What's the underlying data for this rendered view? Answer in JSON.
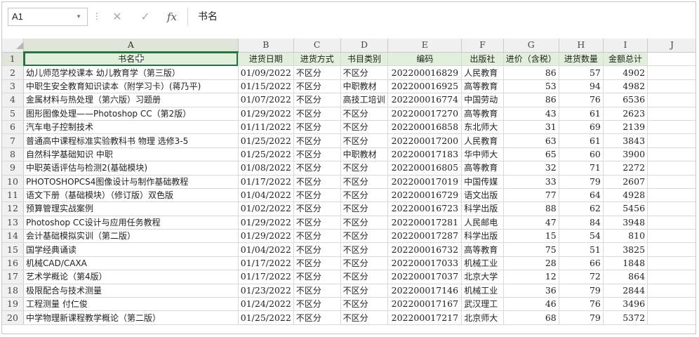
{
  "name_box": "A1",
  "formula_bar": {
    "value": "书名",
    "fx_label": "fx",
    "cancel_symbol": "✕",
    "enter_symbol": "✓"
  },
  "columns": [
    "A",
    "B",
    "C",
    "D",
    "E",
    "F",
    "G",
    "H",
    "I",
    "J"
  ],
  "headers": [
    "书名",
    "进货日期",
    "进货方式",
    "书目类别",
    "编码",
    "出版社",
    "进价（含税）",
    "进货数量",
    "金额总计"
  ],
  "rows": [
    {
      "n": "2",
      "title": "幼儿师范学校课本 幼儿教育学（第三版）",
      "date": "01/09/2022",
      "method": "不区分",
      "category": "不区分",
      "code": "202200016829",
      "publisher": "人民教育",
      "price": "86",
      "qty": "57",
      "total": "4902"
    },
    {
      "n": "3",
      "title": "中职生安全教育知识读本（附学习卡）(蒋乃平)",
      "date": "01/15/2022",
      "method": "不区分",
      "category": "中职教材",
      "code": "202200016925",
      "publisher": "高等教育",
      "price": "53",
      "qty": "94",
      "total": "4982"
    },
    {
      "n": "4",
      "title": "金属材料与热处理（第六版）习题册",
      "date": "01/07/2022",
      "method": "不区分",
      "category": "高技工培训",
      "code": "202200016774",
      "publisher": "中国劳动",
      "price": "86",
      "qty": "76",
      "total": "6536"
    },
    {
      "n": "5",
      "title": "图形图像处理——Photoshop CC（第2版）",
      "date": "01/29/2022",
      "method": "不区分",
      "category": "不区分",
      "code": "202200017270",
      "publisher": "高等教育",
      "price": "43",
      "qty": "61",
      "total": "2623"
    },
    {
      "n": "6",
      "title": "汽车电子控制技术",
      "date": "01/11/2022",
      "method": "不区分",
      "category": "不区分",
      "code": "202200016858",
      "publisher": "东北师大",
      "price": "31",
      "qty": "69",
      "total": "2139"
    },
    {
      "n": "7",
      "title": "普通高中课程标准实验教科书 物理 选修3-5",
      "date": "01/25/2022",
      "method": "不区分",
      "category": "不区分",
      "code": "202200017200",
      "publisher": "人民教育",
      "price": "63",
      "qty": "61",
      "total": "3843"
    },
    {
      "n": "8",
      "title": "自然科学基础知识 中职",
      "date": "01/25/2022",
      "method": "不区分",
      "category": "中职教材",
      "code": "202200017183",
      "publisher": "华中师大",
      "price": "65",
      "qty": "60",
      "total": "3900"
    },
    {
      "n": "9",
      "title": "中职英语评估与检测2(基础模块)",
      "date": "01/08/2022",
      "method": "不区分",
      "category": "不区分",
      "code": "202200016805",
      "publisher": "高等教育",
      "price": "32",
      "qty": "71",
      "total": "2272"
    },
    {
      "n": "10",
      "title": "PHOTOSHOPCS4图像设计与制作基础教程",
      "date": "01/17/2022",
      "method": "不区分",
      "category": "不区分",
      "code": "202200017019",
      "publisher": "中国传媒",
      "price": "33",
      "qty": "79",
      "total": "2607"
    },
    {
      "n": "11",
      "title": "语文下册（基础模块）（修订版）双色版",
      "date": "01/04/2022",
      "method": "不区分",
      "category": "不区分",
      "code": "202200016729",
      "publisher": "语文出版",
      "price": "77",
      "qty": "64",
      "total": "4928"
    },
    {
      "n": "12",
      "title": "预算管理实战案例",
      "date": "01/02/2022",
      "method": "不区分",
      "category": "不区分",
      "code": "202200016723",
      "publisher": "科学出版",
      "price": "88",
      "qty": "62",
      "total": "5456"
    },
    {
      "n": "13",
      "title": "Photoshop CC设计与应用任务教程",
      "date": "01/29/2022",
      "method": "不区分",
      "category": "不区分",
      "code": "202200017281",
      "publisher": "人民邮电",
      "price": "47",
      "qty": "84",
      "total": "3948"
    },
    {
      "n": "14",
      "title": "会计基础模拟实训（第二版）",
      "date": "01/29/2022",
      "method": "不区分",
      "category": "不区分",
      "code": "202200017287",
      "publisher": "科学出版",
      "price": "15",
      "qty": "54",
      "total": "810"
    },
    {
      "n": "15",
      "title": "国学经典诵读",
      "date": "01/04/2022",
      "method": "不区分",
      "category": "不区分",
      "code": "202200016732",
      "publisher": "高等教育",
      "price": "75",
      "qty": "51",
      "total": "3825"
    },
    {
      "n": "16",
      "title": "机械CAD/CAXA",
      "date": "01/17/2022",
      "method": "不区分",
      "category": "不区分",
      "code": "202200017033",
      "publisher": "机械工业",
      "price": "28",
      "qty": "66",
      "total": "1848"
    },
    {
      "n": "17",
      "title": "艺术学概论（第4版）",
      "date": "01/17/2022",
      "method": "不区分",
      "category": "不区分",
      "code": "202200017037",
      "publisher": "北京大学",
      "price": "12",
      "qty": "72",
      "total": "864"
    },
    {
      "n": "18",
      "title": "极限配合与技术测量",
      "date": "01/23/2022",
      "method": "不区分",
      "category": "不区分",
      "code": "202200017146",
      "publisher": "机械工业",
      "price": "36",
      "qty": "79",
      "total": "2844"
    },
    {
      "n": "19",
      "title": "工程测量 付仁俊",
      "date": "01/24/2022",
      "method": "不区分",
      "category": "不区分",
      "code": "202200017167",
      "publisher": "武汉理工",
      "price": "46",
      "qty": "76",
      "total": "3496"
    },
    {
      "n": "20",
      "title": "中学物理新课程教学概论（第二版）",
      "date": "01/25/2022",
      "method": "不区分",
      "category": "不区分",
      "code": "202200017217",
      "publisher": "北京师大",
      "price": "68",
      "qty": "79",
      "total": "5372"
    }
  ]
}
